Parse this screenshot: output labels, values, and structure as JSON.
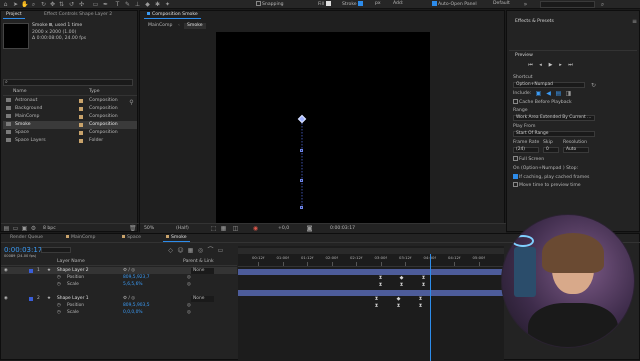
{
  "toolbar": {
    "snapping": "Snapping",
    "fill": "Fill",
    "stroke": "Stroke",
    "stroke_width": "px",
    "add": "Add:",
    "auto_open_panel": "Auto-Open Panel",
    "workspace": "Default"
  },
  "project": {
    "tab_project": "Project",
    "tab_effect_controls": "Effect Controls Shape Layer 2",
    "item_name": "Smoke",
    "item_used": ", used 1 time",
    "item_size": "2000 x 2000 (1.00)",
    "item_duration": "Δ 0:00:08:00, 24.00 fps",
    "search_placeholder": "",
    "col_name": "Name",
    "col_type": "Type",
    "items": [
      {
        "name": "Astronaut",
        "type": "Composition",
        "color": "#c9a36b",
        "folder": false
      },
      {
        "name": "Background",
        "type": "Composition",
        "color": "#c9a36b",
        "folder": false
      },
      {
        "name": "MainComp",
        "type": "Composition",
        "color": "#c9a36b",
        "folder": false
      },
      {
        "name": "Smoke",
        "type": "Composition",
        "color": "#c9a36b",
        "folder": false
      },
      {
        "name": "Space",
        "type": "Composition",
        "color": "#c9a36b",
        "folder": false
      },
      {
        "name": "Space Layers",
        "type": "Folder",
        "color": "#c9a36b",
        "folder": true
      }
    ],
    "bpc": "8 bpc"
  },
  "composition": {
    "tab": "Composition Smoke",
    "crumb1": "MainComp",
    "crumb2": "Smoke",
    "zoom": "50%",
    "resolution": "(Half)",
    "exposure": "+0,0",
    "timecode": "0:00:03:17"
  },
  "effects": {
    "title": "Effects & Presets",
    "preview": "Preview",
    "shortcut_label": "Shortcut",
    "shortcut_value": "Option+Numpad",
    "include_label": "Include:",
    "cache_before": "Cache Before Playback",
    "range_label": "Range",
    "range_value": "Work Area Extended By Current ...",
    "play_from_label": "Play From",
    "play_from_value": "Start Of Range",
    "frame_rate_label": "Frame Rate",
    "skip_label": "Skip",
    "resolution_label": "Resolution",
    "frame_rate_value": "(24)",
    "skip_value": "0",
    "resolution_value": "Auto",
    "full_screen": "Full Screen",
    "stop_label": "On (Option+Numpad ) Stop:",
    "if_caching": "If caching, play cached frames",
    "move_time": "Move time to preview time"
  },
  "timeline": {
    "tabs": [
      "Render Queue",
      "MainComp",
      "Space",
      "Smoke"
    ],
    "active_tab": 3,
    "timecode": "0:00:03:17",
    "timecode_sub": "00089 (24.00 fps)",
    "col_layer_name": "Layer Name",
    "col_parent": "Parent & Link",
    "ruler": [
      "00:12f",
      "01:00f",
      "01:12f",
      "02:00f",
      "02:12f",
      "03:00f",
      "03:12f",
      "04:00f",
      "04:12f",
      "05:00f"
    ],
    "layers": [
      {
        "num": "1",
        "name": "Shape Layer 2",
        "parent": "None",
        "kind": "layer",
        "selected": true
      },
      {
        "num": "",
        "name": "Position",
        "value": "809,5,923,7",
        "kind": "prop",
        "selected": false
      },
      {
        "num": "",
        "name": "Scale",
        "value": "5,6,5,6%",
        "kind": "prop",
        "selected": false
      },
      {
        "num": "2",
        "name": "Shape Layer 1",
        "parent": "None",
        "kind": "layer",
        "selected": false
      },
      {
        "num": "",
        "name": "Position",
        "value": "809,5,903,5",
        "kind": "prop",
        "selected": false
      },
      {
        "num": "",
        "name": "Scale",
        "value": "0,0,0,0%",
        "kind": "prop",
        "selected": false
      }
    ],
    "playhead_position": 0.72,
    "colors": {
      "layer_bar": "#4d5c9a",
      "label_blue": "#3a5ed8",
      "playhead": "#2d8ceb"
    }
  }
}
